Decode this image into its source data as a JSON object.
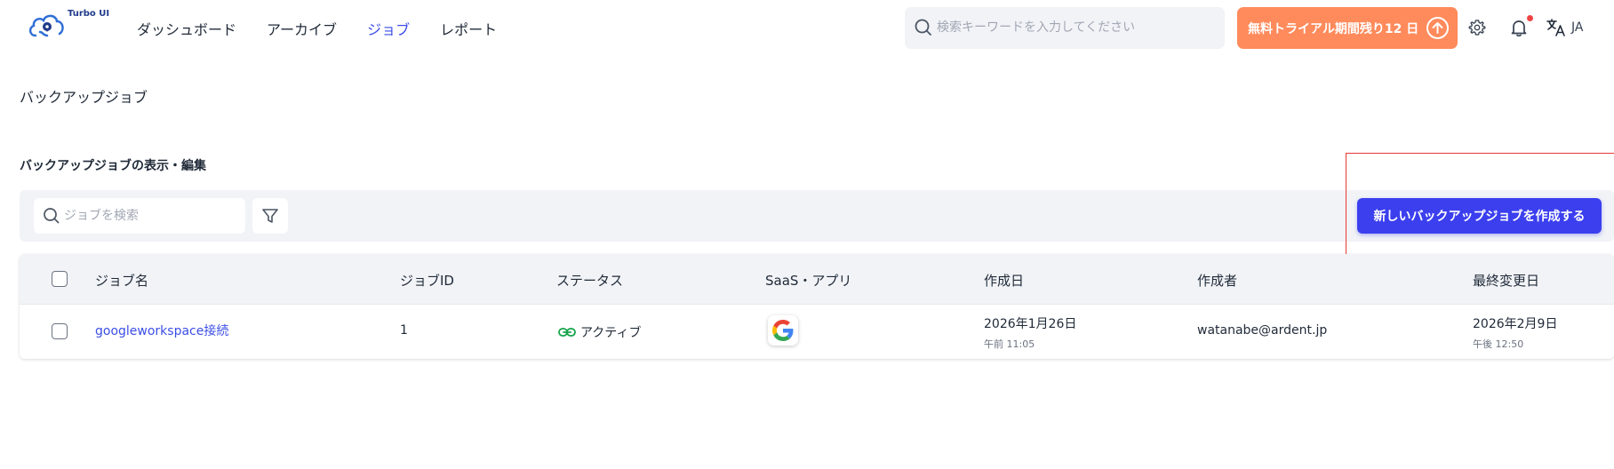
{
  "app": {
    "logo_text": "Turbo UI"
  },
  "nav": {
    "items": [
      {
        "label": "ダッシュボード",
        "active": false
      },
      {
        "label": "アーカイブ",
        "active": false
      },
      {
        "label": "ジョブ",
        "active": true
      },
      {
        "label": "レポート",
        "active": false
      }
    ]
  },
  "header": {
    "search_placeholder": "検索キーワードを入力してください",
    "trial_label": "無料トライアル期間残り12 日",
    "language": "JA"
  },
  "page": {
    "title": "バックアップジョブ",
    "section_title": "バックアップジョブの表示・編集"
  },
  "toolbar": {
    "search_placeholder": "ジョブを検索",
    "create_button": "新しいバックアップジョブを作成する"
  },
  "table": {
    "columns": [
      "ジョブ名",
      "ジョブID",
      "ステータス",
      "SaaS・アプリ",
      "作成日",
      "作成者",
      "最終変更日"
    ],
    "rows": [
      {
        "name": "googleworkspace接続",
        "id": "1",
        "status": "アクティブ",
        "app_icon": "google-icon",
        "created_date": "2026年1月26日",
        "created_time": "午前 11:05",
        "creator": "watanabe@ardent.jp",
        "modified_date": "2026年2月9日",
        "modified_time": "午後 12:50"
      }
    ]
  },
  "colors": {
    "accent": "#3b3fee",
    "trial": "#ff8a5b",
    "active_nav": "#3b4ee6",
    "status_active": "#16a34a",
    "highlight_box": "#e53935"
  }
}
